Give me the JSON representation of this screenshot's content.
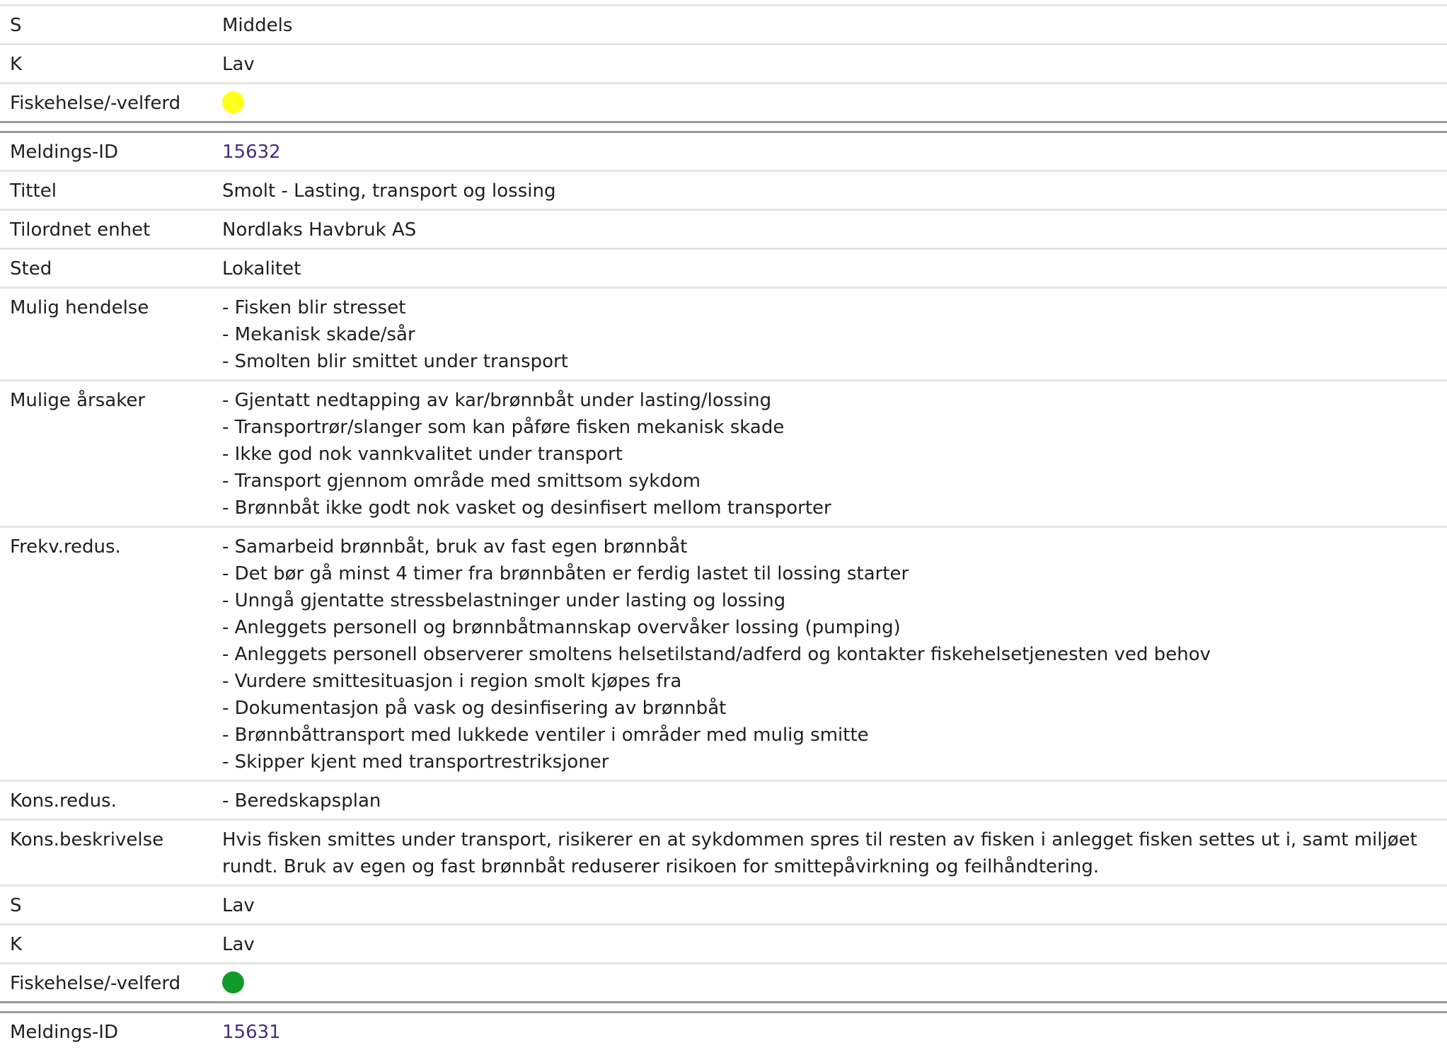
{
  "block_top": {
    "rows": [
      {
        "label": "S",
        "value": "Middels"
      },
      {
        "label": "K",
        "value": "Lav"
      },
      {
        "label": "Fiskehelse/-velferd",
        "indicator_color": "#ffff1a"
      }
    ]
  },
  "block_main": {
    "id_label": "Meldings-ID",
    "id_value": "15632",
    "title_label": "Tittel",
    "title_value": "Smolt - Lasting, transport og lossing",
    "unit_label": "Tilordnet enhet",
    "unit_value": "Nordlaks Havbruk AS",
    "place_label": "Sted",
    "place_value": "Lokalitet",
    "event_label": "Mulig hendelse",
    "events": [
      "- Fisken blir stresset",
      "- Mekanisk skade/sår",
      "- Smolten blir smittet under transport"
    ],
    "causes_label": "Mulige årsaker",
    "causes": [
      "- Gjentatt nedtapping av kar/brønnbåt under lasting/lossing",
      "- Transportrør/slanger som kan påføre fisken mekanisk skade",
      "- Ikke god nok vannkvalitet under transport",
      "- Transport gjennom område med smittsom sykdom",
      "- Brønnbåt ikke godt nok vasket og desinfisert mellom transporter"
    ],
    "freq_label": "Frekv.redus.",
    "freq": [
      "- Samarbeid brønnbåt, bruk av fast egen brønnbåt",
      "- Det bør gå minst 4 timer fra brønnbåten er ferdig lastet til lossing starter",
      "- Unngå gjentatte stressbelastninger under lasting og lossing",
      "- Anleggets personell og brønnbåtmannskap overvåker lossing (pumping)",
      "- Anleggets personell observerer smoltens helsetilstand/adferd og kontakter fiskehelsetjenesten ved behov",
      "- Vurdere smittesituasjon i region smolt kjøpes fra",
      "- Dokumentasjon på vask og desinfisering av brønnbåt",
      "- Brønnbåttransport med lukkede ventiler i områder med mulig smitte",
      "- Skipper kjent med transportrestriksjoner"
    ],
    "kons_label": "Kons.redus.",
    "kons": [
      "- Beredskapsplan"
    ],
    "konsdesc_label": "Kons.beskrivelse",
    "konsdesc_value": "Hvis fisken smittes under transport, risikerer en at sykdommen spres til resten av fisken i anlegget fisken settes ut i, samt miljøet rundt. Bruk av egen og fast brønnbåt reduserer risikoen for smittepåvirkning og feilhåndtering.",
    "s_label": "S",
    "s_value": "Lav",
    "k_label": "K",
    "k_value": "Lav",
    "health_label": "Fiskehelse/-velferd",
    "health_color": "#119a2a"
  },
  "block_next": {
    "id_label": "Meldings-ID",
    "id_value": "15631"
  }
}
